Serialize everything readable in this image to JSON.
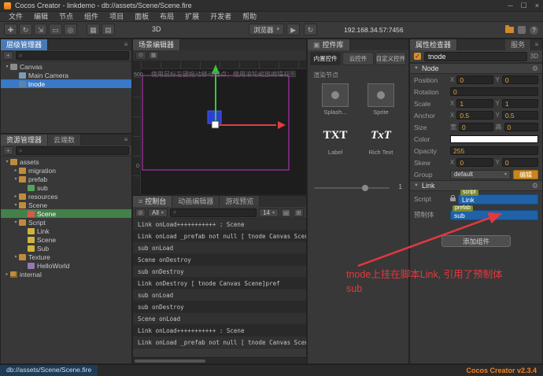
{
  "window": {
    "title": "Cocos Creator - linkdemo - db://assets/Scene/Scene.fire",
    "minimize_glyph": "─",
    "maximize_glyph": "☐",
    "close_glyph": "×"
  },
  "menu_bar": {
    "items": [
      "文件",
      "编辑",
      "节点",
      "组件",
      "项目",
      "面板",
      "布局",
      "扩展",
      "开发者",
      "帮助"
    ]
  },
  "toolbar": {
    "mode_label": "3D",
    "preview_target": "浏览器",
    "play_glyph": "▶",
    "refresh_glyph": "↻",
    "address": "192.168.34.57:7456"
  },
  "hierarchy": {
    "title": "层级管理器",
    "nodes": [
      {
        "label": "Canvas",
        "indent": 0,
        "arrow": "▾",
        "icon": "canvas",
        "selected": false
      },
      {
        "label": "Main Camera",
        "indent": 1,
        "arrow": "",
        "icon": "camera",
        "selected": false
      },
      {
        "label": "tnode",
        "indent": 1,
        "arrow": "",
        "icon": "node",
        "selected": true
      }
    ]
  },
  "assets": {
    "tabs": [
      "资源管理器",
      "云端数"
    ],
    "items": [
      {
        "label": "assets",
        "indent": 0,
        "arrow": "▾",
        "icon": "folder",
        "selected": false
      },
      {
        "label": "migration",
        "indent": 1,
        "arrow": "▸",
        "icon": "folder",
        "selected": false
      },
      {
        "label": "prefab",
        "indent": 1,
        "arrow": "▾",
        "icon": "folder",
        "selected": false
      },
      {
        "label": "sub",
        "indent": 2,
        "arrow": "",
        "icon": "prefab",
        "selected": false
      },
      {
        "label": "resources",
        "indent": 1,
        "arrow": "▸",
        "icon": "folder",
        "selected": false
      },
      {
        "label": "Scene",
        "indent": 1,
        "arrow": "▾",
        "icon": "folder",
        "selected": false
      },
      {
        "label": "Scene",
        "indent": 2,
        "arrow": "",
        "icon": "scene",
        "selected": true
      },
      {
        "label": "Script",
        "indent": 1,
        "arrow": "▾",
        "icon": "folder",
        "selected": false
      },
      {
        "label": "Link",
        "indent": 2,
        "arrow": "",
        "icon": "script",
        "selected": false
      },
      {
        "label": "Scene",
        "indent": 2,
        "arrow": "",
        "icon": "script",
        "selected": false
      },
      {
        "label": "Sub",
        "indent": 2,
        "arrow": "",
        "icon": "script",
        "selected": false
      },
      {
        "label": "Texture",
        "indent": 1,
        "arrow": "▾",
        "icon": "folder",
        "selected": false
      },
      {
        "label": "HelloWorld",
        "indent": 2,
        "arrow": "",
        "icon": "image",
        "selected": false
      },
      {
        "label": "internal",
        "indent": 0,
        "arrow": "▸",
        "icon": "folder-locked",
        "selected": false
      }
    ]
  },
  "scene_editor": {
    "tab": "场景编辑器",
    "hint": "使用鼠标左键拖动移动锚点；使用滚轮缩放编辑视图",
    "ruler_left_top": "500",
    "ruler_left_bottom": "0"
  },
  "console": {
    "tabs": [
      "控制台",
      "动画编辑器",
      "游戏预览"
    ],
    "level_filter": "All",
    "font_size": "14",
    "lines": [
      "Link onLoad+++++++++++ : Scene",
      "Link onLoad _prefab not null [ tnode Canvas Scene]null",
      "sub onLoad",
      "Scene onDestroy",
      "sub onDestroy",
      "Link onDestroy [ tnode Canvas Scene]pref",
      "sub onLoad",
      "sub onDestroy",
      "Scene onLoad",
      "Link onLoad+++++++++++ : Scene",
      "Link onLoad _prefab not null [ tnode Canvas Scene]pref"
    ]
  },
  "widget_library": {
    "title": "控件库",
    "tabs": [
      "内置控件",
      "云控件",
      "自定义控件"
    ],
    "section_label": "渲染节点",
    "items": [
      {
        "label": "Splash...",
        "glyph": "sprite",
        "italic": false
      },
      {
        "label": "Sprite",
        "glyph": "sprite",
        "italic": false
      },
      {
        "label": "Label",
        "glyph": "TXT",
        "italic": false
      },
      {
        "label": "Rich Text",
        "glyph": "TxT",
        "italic": true
      }
    ],
    "zoom_value": "1"
  },
  "inspector": {
    "tab": "属性检查器",
    "service_tab": "服务",
    "check_glyph": "✓",
    "node_name": "tnode",
    "mode_label": "3D",
    "node_section_label": "Node",
    "rows": [
      {
        "label": "Position",
        "fields": [
          {
            "axis": "X",
            "value": "0"
          },
          {
            "axis": "Y",
            "value": "0"
          }
        ]
      },
      {
        "label": "Rotation",
        "fields": [
          {
            "axis": "",
            "value": "0"
          }
        ]
      },
      {
        "label": "Scale",
        "fields": [
          {
            "axis": "X",
            "value": "1"
          },
          {
            "axis": "Y",
            "value": "1"
          }
        ]
      },
      {
        "label": "Anchor",
        "fields": [
          {
            "axis": "X",
            "value": "0.5"
          },
          {
            "axis": "Y",
            "value": "0.5"
          }
        ]
      },
      {
        "label": "Size",
        "fields": [
          {
            "axis": "宽",
            "value": "0"
          },
          {
            "axis": "高",
            "value": "0"
          }
        ]
      },
      {
        "label": "Color",
        "color": "#ffffff"
      },
      {
        "label": "Opacity",
        "fields": [
          {
            "axis": "",
            "value": "255"
          }
        ]
      },
      {
        "label": "Skew",
        "fields": [
          {
            "axis": "X",
            "value": "0"
          },
          {
            "axis": "Y",
            "value": "0"
          }
        ]
      },
      {
        "label": "Group",
        "dropdown": "default",
        "button_label": "编辑"
      }
    ],
    "link_section_label": "Link",
    "script_row": {
      "label": "Script",
      "badge": "script",
      "value": "Link"
    },
    "prefab_row": {
      "label": "预制体",
      "badge": "prefab",
      "value": "sub"
    },
    "add_component_label": "添加组件"
  },
  "annotation": {
    "line1": "tnode上挂在脚本Link, 引用了预制体",
    "line2": "sub"
  },
  "status_bar": {
    "left": "db://assets/Scene/Scene.fire",
    "right": "Cocos Creator v2.3.4"
  }
}
